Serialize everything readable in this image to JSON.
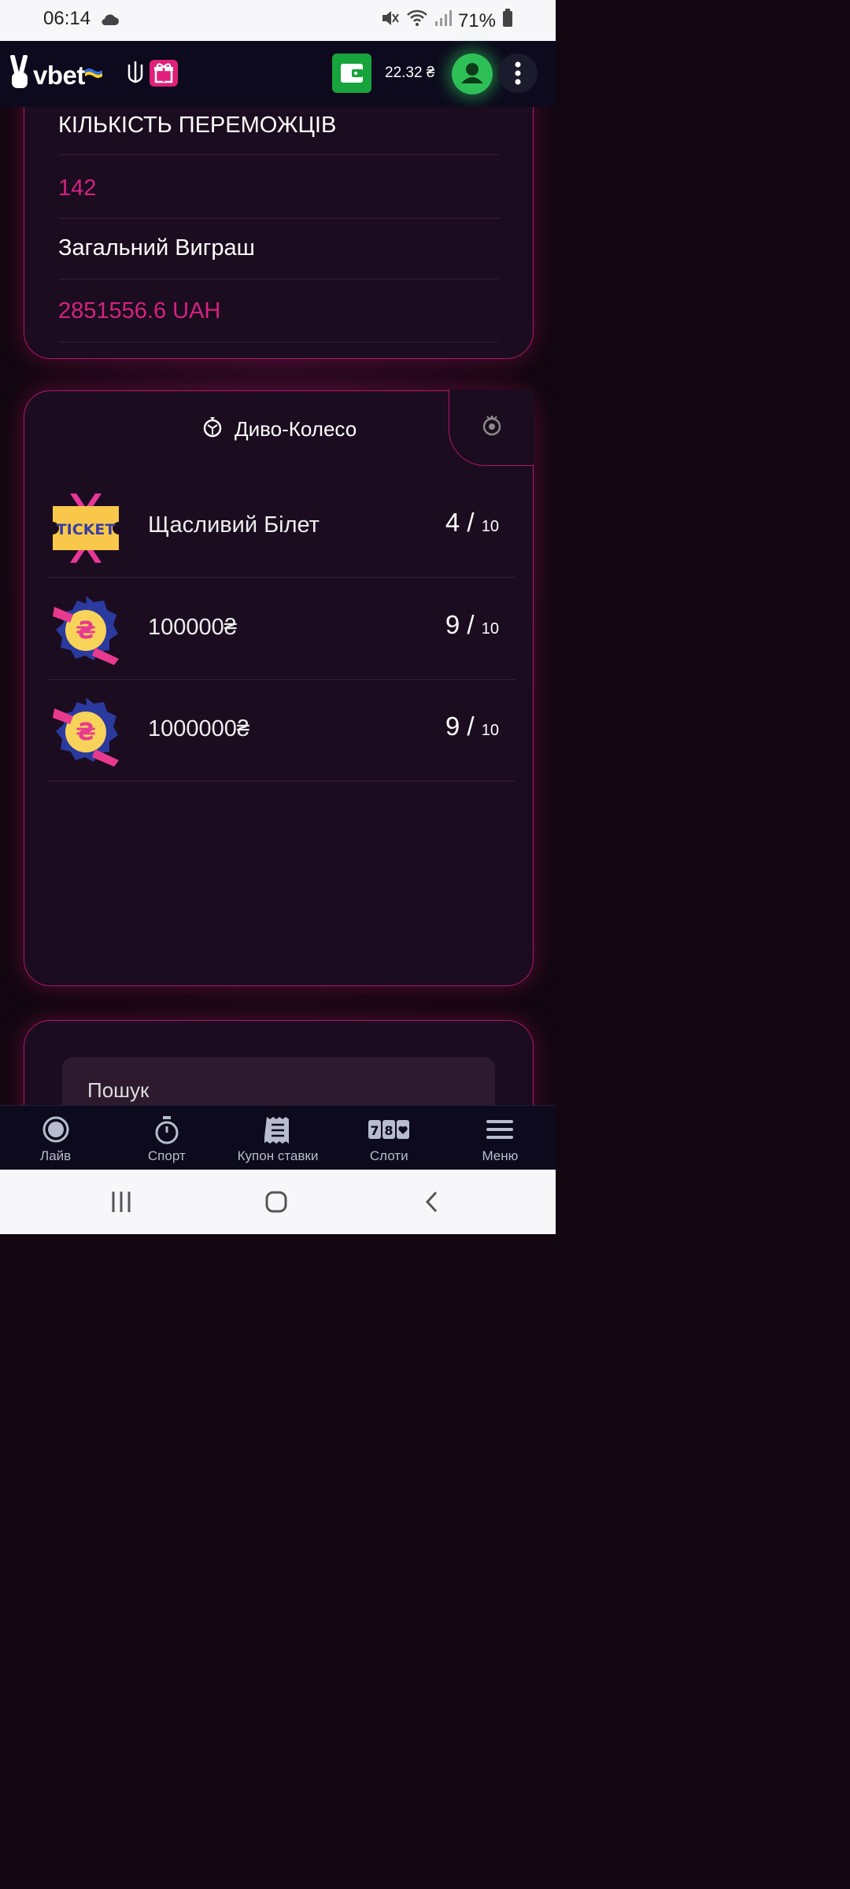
{
  "status_bar": {
    "time": "06:14",
    "battery": "71%"
  },
  "header": {
    "brand": "vbet",
    "balance": "22.32 ₴"
  },
  "stats": {
    "winners_label": "КІЛЬКІСТЬ ПЕРЕМОЖЦІВ",
    "winners_value": "142",
    "total_label": "Загальний Виграш",
    "total_value": "2851556.6 UAH"
  },
  "wheel": {
    "title": "Диво-Колесо",
    "prizes": [
      {
        "name": "Щасливий Білет",
        "current": "4 /",
        "max": "10",
        "icon": "ticket-icon"
      },
      {
        "name": "100000₴",
        "current": "9 /",
        "max": "10",
        "icon": "hryvnia-badge-icon"
      },
      {
        "name": "1000000₴",
        "current": "9 /",
        "max": "10",
        "icon": "hryvnia-badge-icon"
      }
    ]
  },
  "search": {
    "placeholder": "Пошук"
  },
  "bottom_nav": {
    "items": [
      {
        "label": "Лайв",
        "icon": "live-icon"
      },
      {
        "label": "Спорт",
        "icon": "stopwatch-icon"
      },
      {
        "label": "Купон ставки",
        "icon": "coupon-icon"
      },
      {
        "label": "Слоти",
        "icon": "slots-icon"
      },
      {
        "label": "Меню",
        "icon": "menu-icon"
      }
    ]
  },
  "colors": {
    "accent": "#d3237f",
    "wallet": "#17a43c",
    "avatar": "#2fbf57"
  }
}
